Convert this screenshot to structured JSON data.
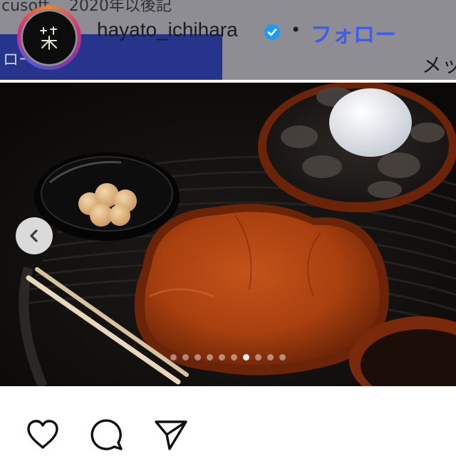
{
  "header": {
    "top_clip_text": "cusoft... 2020年以後記",
    "follow_chip_label": "ロー",
    "username": "hayato_ichihara",
    "verified": true,
    "separator": "•",
    "follow_label": "フォロー",
    "right_clip_text": "メッ",
    "colors": {
      "follow": "#3f5bf0",
      "verified": "#1d9bf0",
      "chip": "#27348b"
    }
  },
  "post": {
    "icons": {
      "carousel_prev": "chevron-left-icon"
    },
    "carousel": {
      "total": 10,
      "active_index": 6
    }
  },
  "actions": {
    "icons": [
      "heart-icon",
      "comment-icon",
      "share-icon"
    ]
  }
}
